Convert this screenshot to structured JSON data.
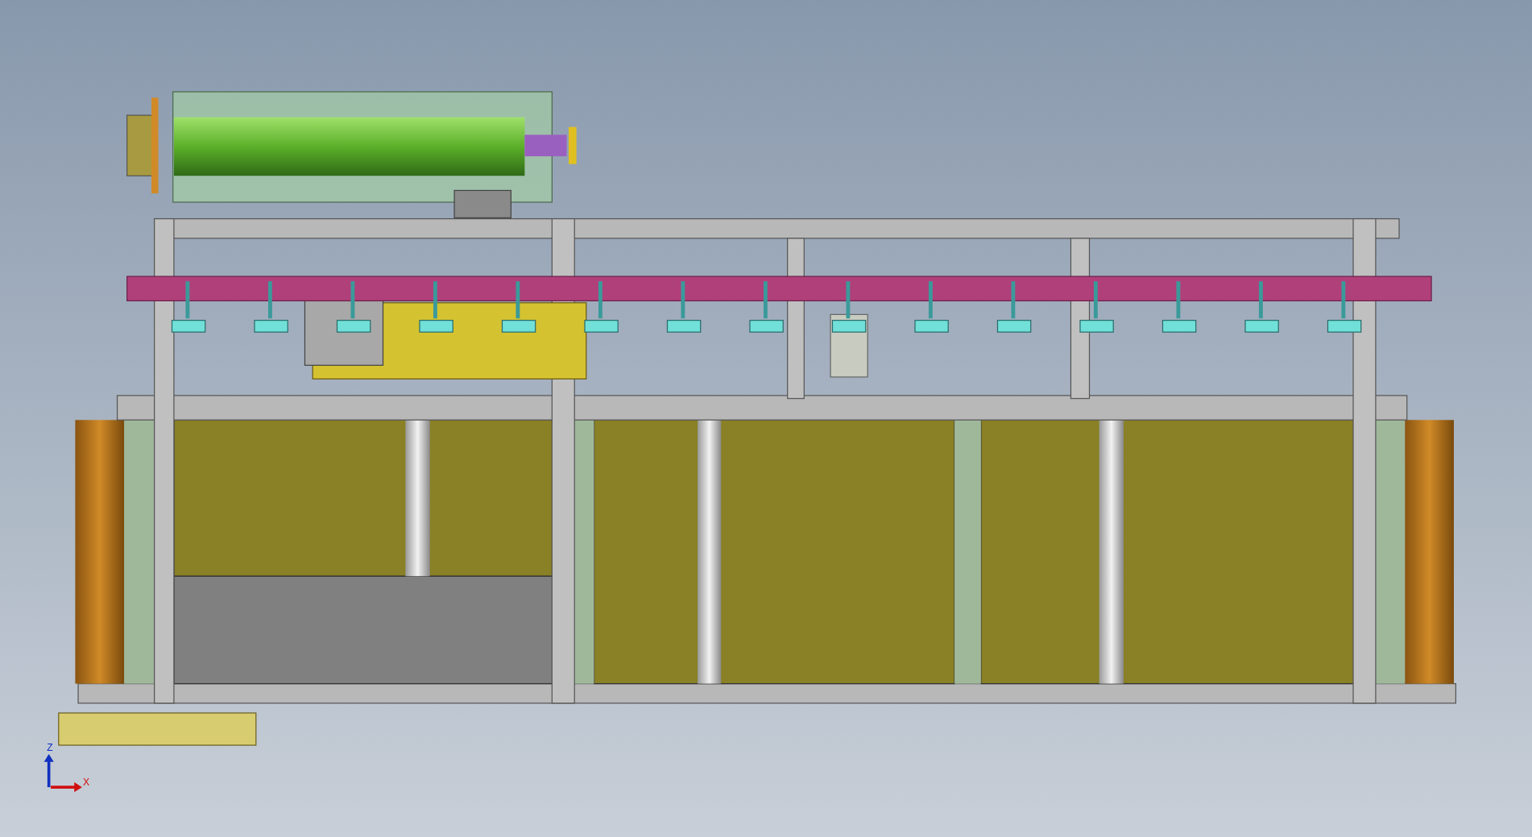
{
  "viewport": {
    "triad": {
      "axes": [
        {
          "kind": "vertical",
          "label": "Z"
        },
        {
          "kind": "horizontal",
          "label": "X"
        }
      ]
    }
  }
}
